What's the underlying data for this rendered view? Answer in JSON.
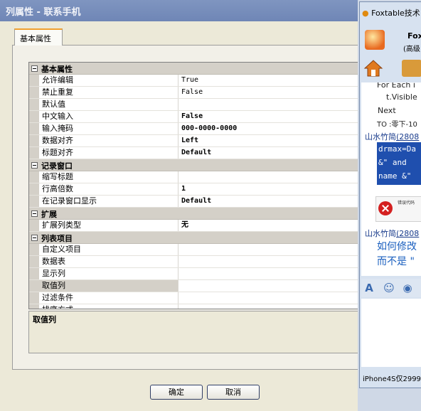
{
  "dialog": {
    "title": "列属性 - 联系手机",
    "tab_label": "基本属性",
    "categories": [
      {
        "label": "基本属性",
        "rows": [
          {
            "name": "允许编辑",
            "value": "True",
            "bold": false
          },
          {
            "name": "禁止重复",
            "value": "False",
            "bold": false
          },
          {
            "name": "默认值",
            "value": "",
            "bold": false
          },
          {
            "name": "中文输入",
            "value": "False",
            "bold": true
          },
          {
            "name": "输入掩码",
            "value": "000-0000-0000",
            "bold": true
          },
          {
            "name": "数据对齐",
            "value": "Left",
            "bold": true
          },
          {
            "name": "标题对齐",
            "value": "Default",
            "bold": true
          }
        ]
      },
      {
        "label": "记录窗口",
        "rows": [
          {
            "name": "缩写标题",
            "value": "",
            "bold": false
          },
          {
            "name": "行高倍数",
            "value": "1",
            "bold": true
          },
          {
            "name": "在记录窗口显示",
            "value": "Default",
            "bold": true
          }
        ]
      },
      {
        "label": "扩展",
        "rows": [
          {
            "name": "扩展列类型",
            "value": "无",
            "bold": true
          }
        ]
      },
      {
        "label": "列表项目",
        "rows": [
          {
            "name": "自定义项目",
            "value": "",
            "bold": false
          },
          {
            "name": "数据表",
            "value": "",
            "bold": false
          },
          {
            "name": "显示列",
            "value": "",
            "bold": false
          },
          {
            "name": "取值列",
            "value": "",
            "bold": false,
            "selected": true
          },
          {
            "name": "过滤条件",
            "value": "",
            "bold": false
          },
          {
            "name": "排序方式",
            "value": "",
            "bold": false
          }
        ]
      }
    ],
    "description_title": "取值列",
    "ok_label": "确定",
    "cancel_label": "取消"
  },
  "chat": {
    "title": "Foxtable技术",
    "name": "Fox",
    "sub": "(高级",
    "lines": {
      "l1": "For Each i",
      "l2": "t.Visible",
      "l3": "Next",
      "l4": "TO :零下-10"
    },
    "user1": "山水竹简",
    "user1_id": "(2808",
    "code": [
      "drmax=Da",
      "&\"  and",
      "name &\""
    ],
    "error_text": "错误代码",
    "user2": "山水竹简",
    "user2_id": "(2808",
    "msg1": "如何修改",
    "msg2": "而不是 \"",
    "status": "iPhone4S仅2999"
  }
}
